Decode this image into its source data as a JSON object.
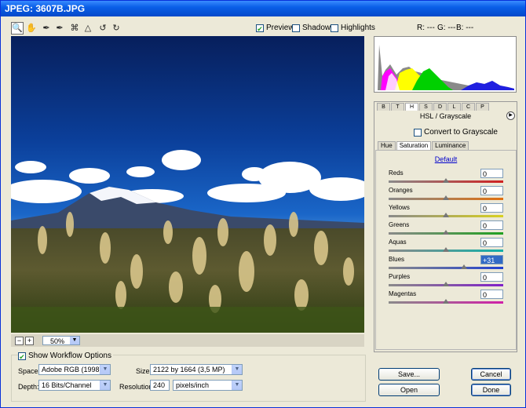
{
  "window": {
    "title": "JPEG:  3607B.JPG"
  },
  "toolbar": {
    "tools": [
      "zoom-tool",
      "hand-tool",
      "white-balance-tool",
      "color-sampler-tool",
      "crop-tool",
      "straighten-tool",
      "rotate-left-tool",
      "rotate-right-tool"
    ],
    "preview_label": "Preview",
    "preview_checked": true,
    "shadows_label": "Shadows",
    "highlights_label": "Highlights"
  },
  "rgb_readout": {
    "r": "R: ---",
    "g": "G: ---",
    "b": "B: ---"
  },
  "image_controls": {
    "zoom_value": "50%"
  },
  "workflow": {
    "show_label": "Show Workflow Options",
    "show_checked": true,
    "space_label": "Space:",
    "space_value": "Adobe RGB (1998)",
    "depth_label": "Depth:",
    "depth_value": "16 Bits/Channel",
    "size_label": "Size:",
    "size_value": "2122 by 1664  (3,5 MP)",
    "resolution_label": "Resolution:",
    "resolution_value": "240",
    "resolution_unit": "pixels/inch"
  },
  "panel": {
    "tabs": [
      "B",
      "T",
      "H",
      "S",
      "D",
      "L",
      "C",
      "P"
    ],
    "active_tab": "H",
    "title": "HSL / Grayscale",
    "convert_label": "Convert to Grayscale",
    "subtabs": [
      "Hue",
      "Saturation",
      "Luminance"
    ],
    "active_subtab": "Saturation",
    "default_link": "Default",
    "sliders": [
      {
        "name": "Reds",
        "value": "0",
        "color": "#d02020",
        "position": 0.5
      },
      {
        "name": "Oranges",
        "value": "0",
        "color": "#e07010",
        "position": 0.5
      },
      {
        "name": "Yellows",
        "value": "0",
        "color": "#d8d020",
        "position": 0.5
      },
      {
        "name": "Greens",
        "value": "0",
        "color": "#20a020",
        "position": 0.5
      },
      {
        "name": "Aquas",
        "value": "0",
        "color": "#10b0a8",
        "position": 0.5
      },
      {
        "name": "Blues",
        "value": "+31",
        "color": "#2040d0",
        "position": 0.655
      },
      {
        "name": "Purples",
        "value": "0",
        "color": "#8020c8",
        "position": 0.5
      },
      {
        "name": "Magentas",
        "value": "0",
        "color": "#d020a8",
        "position": 0.5
      }
    ]
  },
  "buttons": {
    "save": "Save...",
    "cancel": "Cancel",
    "open": "Open",
    "done": "Done"
  }
}
